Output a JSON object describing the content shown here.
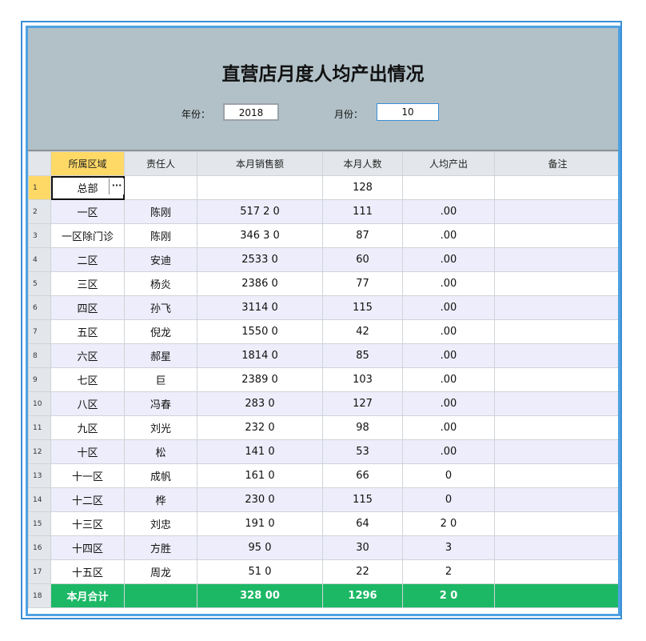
{
  "title": "直营店月度人均产出情况",
  "filters": {
    "year_label": "年份：",
    "year_value": "2018",
    "month_label": "月份：",
    "month_value": "10"
  },
  "columns": [
    "所属区域",
    "责任人",
    "本月销售额",
    "本月人数",
    "人均产出",
    "备注"
  ],
  "rows": [
    {
      "num": "1",
      "region": "总部",
      "person": "",
      "sales": "",
      "count": "128",
      "avg": "",
      "note": ""
    },
    {
      "num": "2",
      "region": "一区",
      "person": "陈刚",
      "sales": "517 2 0",
      "count": "111",
      "avg": ".00",
      "note": ""
    },
    {
      "num": "3",
      "region": "一区除门诊",
      "person": "陈刚",
      "sales": "346 3 0",
      "count": "87",
      "avg": ".00",
      "note": ""
    },
    {
      "num": "4",
      "region": "二区",
      "person": "安迪",
      "sales": "2533 0",
      "count": "60",
      "avg": ".00",
      "note": ""
    },
    {
      "num": "5",
      "region": "三区",
      "person": "杨炎",
      "sales": "2386 0",
      "count": "77",
      "avg": ".00",
      "note": ""
    },
    {
      "num": "6",
      "region": "四区",
      "person": "孙飞",
      "sales": "3114 0",
      "count": "115",
      "avg": ".00",
      "note": ""
    },
    {
      "num": "7",
      "region": "五区",
      "person": "倪龙",
      "sales": "1550 0",
      "count": "42",
      "avg": ".00",
      "note": ""
    },
    {
      "num": "8",
      "region": "六区",
      "person": "郝星",
      "sales": "1814 0",
      "count": "85",
      "avg": ".00",
      "note": ""
    },
    {
      "num": "9",
      "region": "七区",
      "person": "巨",
      "sales": "2389 0",
      "count": "103",
      "avg": ".00",
      "note": ""
    },
    {
      "num": "10",
      "region": "八区",
      "person": "冯春",
      "sales": "283 0",
      "count": "127",
      "avg": ".00",
      "note": ""
    },
    {
      "num": "11",
      "region": "九区",
      "person": "刘光",
      "sales": "232 0",
      "count": "98",
      "avg": ".00",
      "note": ""
    },
    {
      "num": "12",
      "region": "十区",
      "person": "松",
      "sales": "141 0",
      "count": "53",
      "avg": ".00",
      "note": ""
    },
    {
      "num": "13",
      "region": "十一区",
      "person": "成帆",
      "sales": "161 0",
      "count": "66",
      "avg": "0",
      "note": ""
    },
    {
      "num": "14",
      "region": "十二区",
      "person": "桦",
      "sales": "230 0",
      "count": "115",
      "avg": "0",
      "note": ""
    },
    {
      "num": "15",
      "region": "十三区",
      "person": "刘忠",
      "sales": "191 0",
      "count": "64",
      "avg": "2 0",
      "note": ""
    },
    {
      "num": "16",
      "region": "十四区",
      "person": "方胜",
      "sales": "95 0",
      "count": "30",
      "avg": "3 ",
      "note": ""
    },
    {
      "num": "17",
      "region": "十五区",
      "person": "周龙",
      "sales": "51 0",
      "count": "22",
      "avg": "2 ",
      "note": ""
    }
  ],
  "total": {
    "num": "18",
    "label": "本月合计",
    "sales": "328 00",
    "count": "1296",
    "avg": "2 0"
  },
  "colors": {
    "header_bg": "#b2c1c8",
    "alt_row": "#ededfb",
    "total_bg": "#1db866",
    "selected": "#ffd966",
    "frame": "#3a8fd6"
  }
}
